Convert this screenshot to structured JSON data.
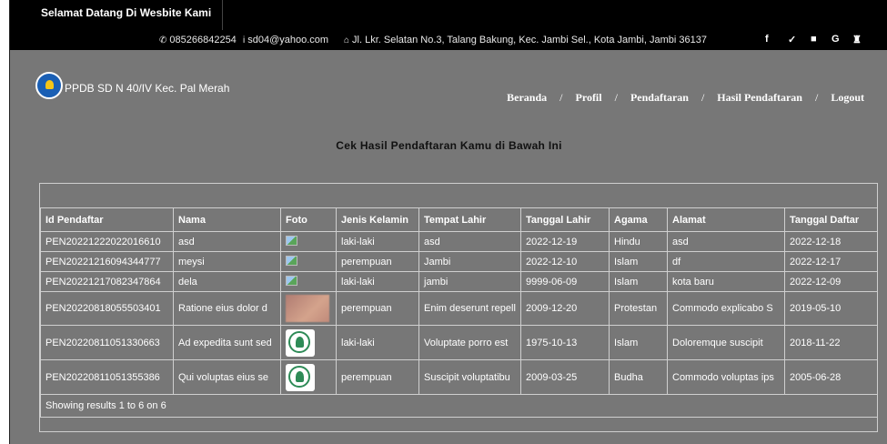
{
  "topbar": {
    "welcome": "Selamat Datang Di Wesbite Kami",
    "phone": "085266842254",
    "email": "sd04@yahoo.com",
    "address": "Jl. Lkr. Selatan No.3, Talang Bakung, Kec. Jambi Sel., Kota Jambi, Jambi 36137",
    "social": [
      "f",
      "✓",
      "■",
      "G",
      "♜"
    ]
  },
  "header": {
    "site_title": "PPDB SD N 40/IV Kec. Pal Merah",
    "nav": [
      "Beranda",
      "Profil",
      "Pendaftaran",
      "Hasil Pendaftaran",
      "Logout"
    ],
    "nav_sep": "/"
  },
  "page": {
    "heading": "Cek Hasil Pendaftaran Kamu di Bawah Ini"
  },
  "table": {
    "columns": [
      "Id Pendaftar",
      "Nama",
      "Foto",
      "Jenis Kelamin",
      "Tempat Lahir",
      "Tanggal Lahir",
      "Agama",
      "Alamat",
      "Tanggal Daftar"
    ],
    "rows": [
      {
        "id": "PEN20221222022016610",
        "nama": "asd",
        "foto": "broken",
        "jk": "laki-laki",
        "tempat": "asd",
        "tgl_lahir": "2022-12-19",
        "agama": "Hindu",
        "alamat": "asd",
        "tgl_daftar": "2022-12-18"
      },
      {
        "id": "PEN20221216094344777",
        "nama": "meysi",
        "foto": "broken",
        "jk": "perempuan",
        "tempat": "Jambi",
        "tgl_lahir": "2022-12-10",
        "agama": "Islam",
        "alamat": "df",
        "tgl_daftar": "2022-12-17"
      },
      {
        "id": "PEN20221217082347864",
        "nama": "dela",
        "foto": "broken",
        "jk": "laki-laki",
        "tempat": "jambi",
        "tgl_lahir": "9999-06-09",
        "agama": "Islam",
        "alamat": "kota baru",
        "tgl_daftar": "2022-12-09"
      },
      {
        "id": "PEN20220818055503401",
        "nama": "Ratione eius dolor d",
        "foto": "photo",
        "jk": "perempuan",
        "tempat": "Enim deserunt repell",
        "tgl_lahir": "2009-12-20",
        "agama": "Protestan",
        "alamat": "Commodo explicabo S",
        "tgl_daftar": "2019-05-10"
      },
      {
        "id": "PEN20220811051330663",
        "nama": "Ad expedita sunt sed",
        "foto": "seal",
        "jk": "laki-laki",
        "tempat": "Voluptate porro est",
        "tgl_lahir": "1975-10-13",
        "agama": "Islam",
        "alamat": "Doloremque suscipit",
        "tgl_daftar": "2018-11-22"
      },
      {
        "id": "PEN20220811051355386",
        "nama": "Qui voluptas eius se",
        "foto": "seal",
        "jk": "perempuan",
        "tempat": "Suscipit voluptatibu",
        "tgl_lahir": "2009-03-25",
        "agama": "Budha",
        "alamat": "Commodo voluptas ips",
        "tgl_daftar": "2005-06-28"
      }
    ],
    "footer": "Showing results 1 to 6 on 6"
  },
  "colors": {
    "background": "#777777",
    "topbar": "#000000",
    "text": "#ffffff"
  }
}
